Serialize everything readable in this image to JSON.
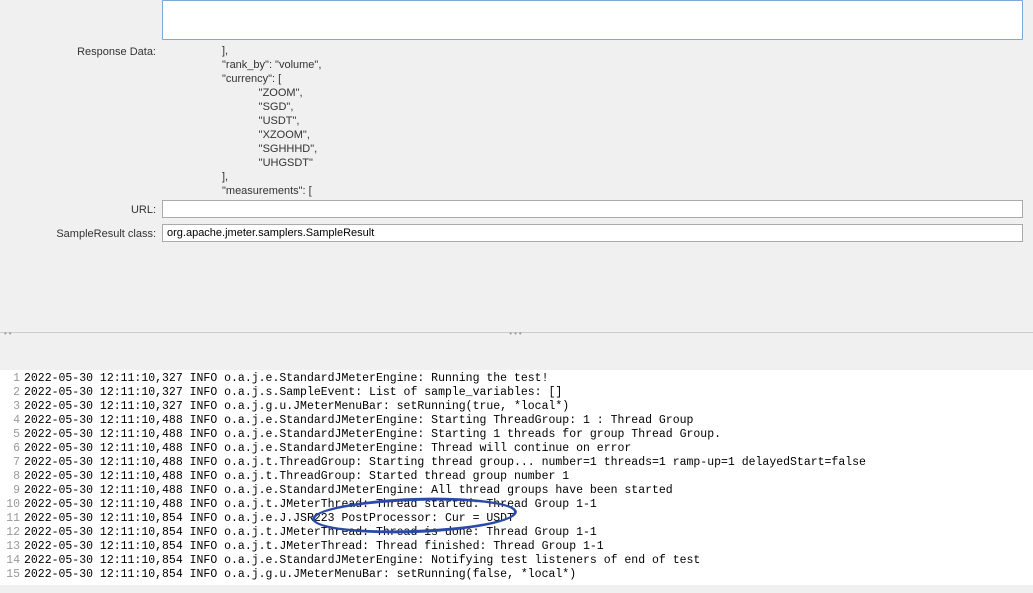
{
  "labels": {
    "responseData": "Response Data:",
    "url": "URL:",
    "sampleResult": "SampleResult class:"
  },
  "responseJson": {
    "lines": [
      "],",
      "\"rank_by\": \"volume\",",
      "\"currency\": [",
      "            \"ZOOM\",",
      "            \"SGD\",",
      "            \"USDT\",",
      "            \"XZOOM\",",
      "            \"SGHHHD\",",
      "            \"UHGSDT\"",
      "],",
      "\"measurements\": ["
    ]
  },
  "urlValue": "",
  "sampleResultValue": "org.apache.jmeter.samplers.SampleResult",
  "log": [
    "2022-05-30 12:11:10,327 INFO o.a.j.e.StandardJMeterEngine: Running the test!",
    "2022-05-30 12:11:10,327 INFO o.a.j.s.SampleEvent: List of sample_variables: []",
    "2022-05-30 12:11:10,327 INFO o.a.j.g.u.JMeterMenuBar: setRunning(true, *local*)",
    "2022-05-30 12:11:10,488 INFO o.a.j.e.StandardJMeterEngine: Starting ThreadGroup: 1 : Thread Group",
    "2022-05-30 12:11:10,488 INFO o.a.j.e.StandardJMeterEngine: Starting 1 threads for group Thread Group.",
    "2022-05-30 12:11:10,488 INFO o.a.j.e.StandardJMeterEngine: Thread will continue on error",
    "2022-05-30 12:11:10,488 INFO o.a.j.t.ThreadGroup: Starting thread group... number=1 threads=1 ramp-up=1 delayedStart=false",
    "2022-05-30 12:11:10,488 INFO o.a.j.t.ThreadGroup: Started thread group number 1",
    "2022-05-30 12:11:10,488 INFO o.a.j.e.StandardJMeterEngine: All thread groups have been started",
    "2022-05-30 12:11:10,488 INFO o.a.j.t.JMeterThread: Thread started: Thread Group 1-1",
    "2022-05-30 12:11:10,854 INFO o.a.j.e.J.JSR223 PostProcessor: Cur = USDT",
    "2022-05-30 12:11:10,854 INFO o.a.j.t.JMeterThread: Thread is done: Thread Group 1-1",
    "2022-05-30 12:11:10,854 INFO o.a.j.t.JMeterThread: Thread finished: Thread Group 1-1",
    "2022-05-30 12:11:10,854 INFO o.a.j.e.StandardJMeterEngine: Notifying test listeners of end of test",
    "2022-05-30 12:11:10,854 INFO o.a.j.g.u.JMeterMenuBar: setRunning(false, *local*)"
  ]
}
